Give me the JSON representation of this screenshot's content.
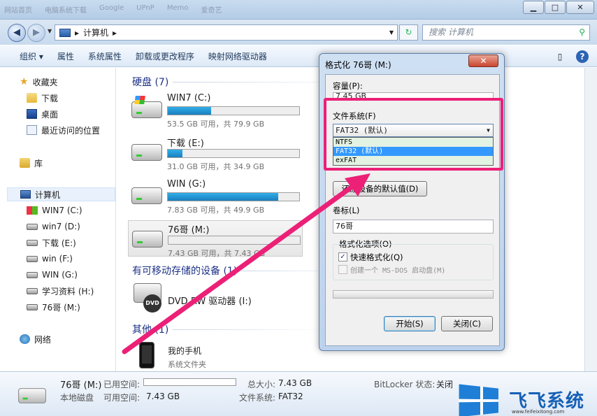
{
  "window": {
    "titlebar_tabs": [
      "网站首页",
      "电脑系统下载",
      "Google",
      "UPnP",
      "Memo",
      "",
      "爱奇艺"
    ]
  },
  "addressbar": {
    "breadcrumb_sep": "▸",
    "path_item": "计算机",
    "search_placeholder": "搜索 计算机"
  },
  "toolbar": {
    "items": [
      "组织 ▾",
      "属性",
      "系统属性",
      "卸载或更改程序",
      "映射网络驱动器"
    ]
  },
  "sidebar": {
    "favorites": "收藏夹",
    "downloads": "下载",
    "desktop": "桌面",
    "recent": "最近访问的位置",
    "libraries": "库",
    "computer": "计算机",
    "drives": [
      "WIN7 (C:)",
      "win7 (D:)",
      "下载 (E:)",
      "win (F:)",
      "WIN (G:)",
      "学习资料 (H:)",
      "76哥 (M:)"
    ],
    "network": "网络"
  },
  "content": {
    "hdd_group": "硬盘 (7)",
    "removable_group": "有可移动存储的设备 (1)",
    "other_group": "其他 (1)",
    "drives": [
      {
        "name": "WIN7 (C:)",
        "info": "53.5 GB 可用，共 79.9 GB",
        "used": 0.33
      },
      {
        "name": "下载 (E:)",
        "info": "31.0 GB 可用，共 34.9 GB",
        "used": 0.11
      },
      {
        "name": "WIN (G:)",
        "info": "7.83 GB 可用，共 49.9 GB",
        "used": 0.84
      },
      {
        "name": "76哥 (M:)",
        "info": "7.43 GB 可用，共 7.43 GB",
        "used": 0.0
      }
    ],
    "dvd_name": "DVD RW 驱动器 (I:)",
    "dvd_tag": "DVD",
    "phone_name": "我的手机",
    "phone_desc": "系统文件夹"
  },
  "details": {
    "name": "76哥 (M:)",
    "type": "本地磁盘",
    "used_label": "已用空间:",
    "free_label": "可用空间:",
    "free_value": "7.43 GB",
    "total_label": "总大小:",
    "total_value": "7.43 GB",
    "fs_label": "文件系统:",
    "fs_value": "FAT32",
    "bitlocker_label": "BitLocker 状态:",
    "bitlocker_value": "关闭"
  },
  "dialog": {
    "title": "格式化 76哥 (M:)",
    "capacity_label": "容量(P):",
    "capacity_value": "7.45 GB",
    "fs_label": "文件系统(F)",
    "fs_selected": "FAT32 (默认)",
    "fs_options": [
      "NTFS",
      "FAT32 (默认)",
      "exFAT"
    ],
    "restore_button": "还原设备的默认值(D)",
    "volume_label": "卷标(L)",
    "volume_value": "76哥",
    "options_group": "格式化选项(O)",
    "quick_format": "快速格式化(Q)",
    "msdos_boot": "创建一个 MS-DOS 启动盘(M)",
    "start_button": "开始(S)",
    "close_button": "关闭(C)"
  },
  "watermark": {
    "brand": "飞飞系统",
    "url": "www.feifeixitong.com"
  },
  "colors": {
    "highlight_box": "#ec2077",
    "arrow": "#ec2077",
    "selection": "#3399ff"
  }
}
